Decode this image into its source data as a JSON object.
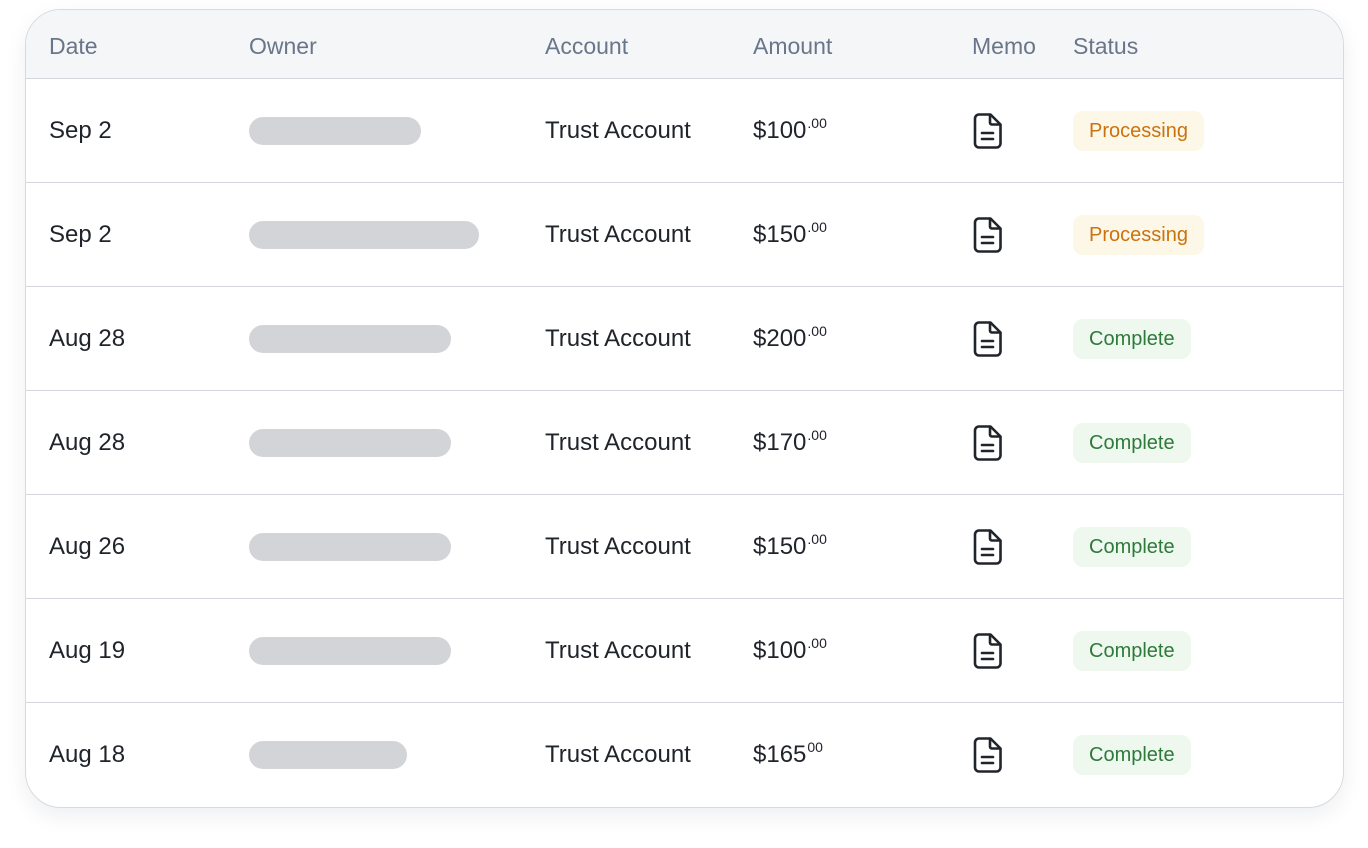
{
  "table": {
    "columns": {
      "date": "Date",
      "owner": "Owner",
      "account": "Account",
      "amount": "Amount",
      "memo": "Memo",
      "status": "Status"
    },
    "memo_icon": "document-icon",
    "status_colors": {
      "Processing": {
        "text": "#c9730f",
        "bg": "#fdf7e8"
      },
      "Complete": {
        "text": "#2e7a3a",
        "bg": "#eef8ef"
      }
    },
    "rows": [
      {
        "date": "Sep 2",
        "account": "Trust Account",
        "amount": "$100",
        "cents": ".00",
        "status": "Processing"
      },
      {
        "date": "Sep 2",
        "account": "Trust Account",
        "amount": "$150",
        "cents": ".00",
        "status": "Processing"
      },
      {
        "date": "Aug 28",
        "account": "Trust Account",
        "amount": "$200",
        "cents": ".00",
        "status": "Complete"
      },
      {
        "date": "Aug 28",
        "account": "Trust Account",
        "amount": "$170",
        "cents": ".00",
        "status": "Complete"
      },
      {
        "date": "Aug 26",
        "account": "Trust Account",
        "amount": "$150",
        "cents": ".00",
        "status": "Complete"
      },
      {
        "date": "Aug 19",
        "account": "Trust Account",
        "amount": "$100",
        "cents": ".00",
        "status": "Complete"
      },
      {
        "date": "Aug 18",
        "account": "Trust Account",
        "amount": "$165",
        "cents": "00",
        "status": "Complete"
      }
    ]
  }
}
